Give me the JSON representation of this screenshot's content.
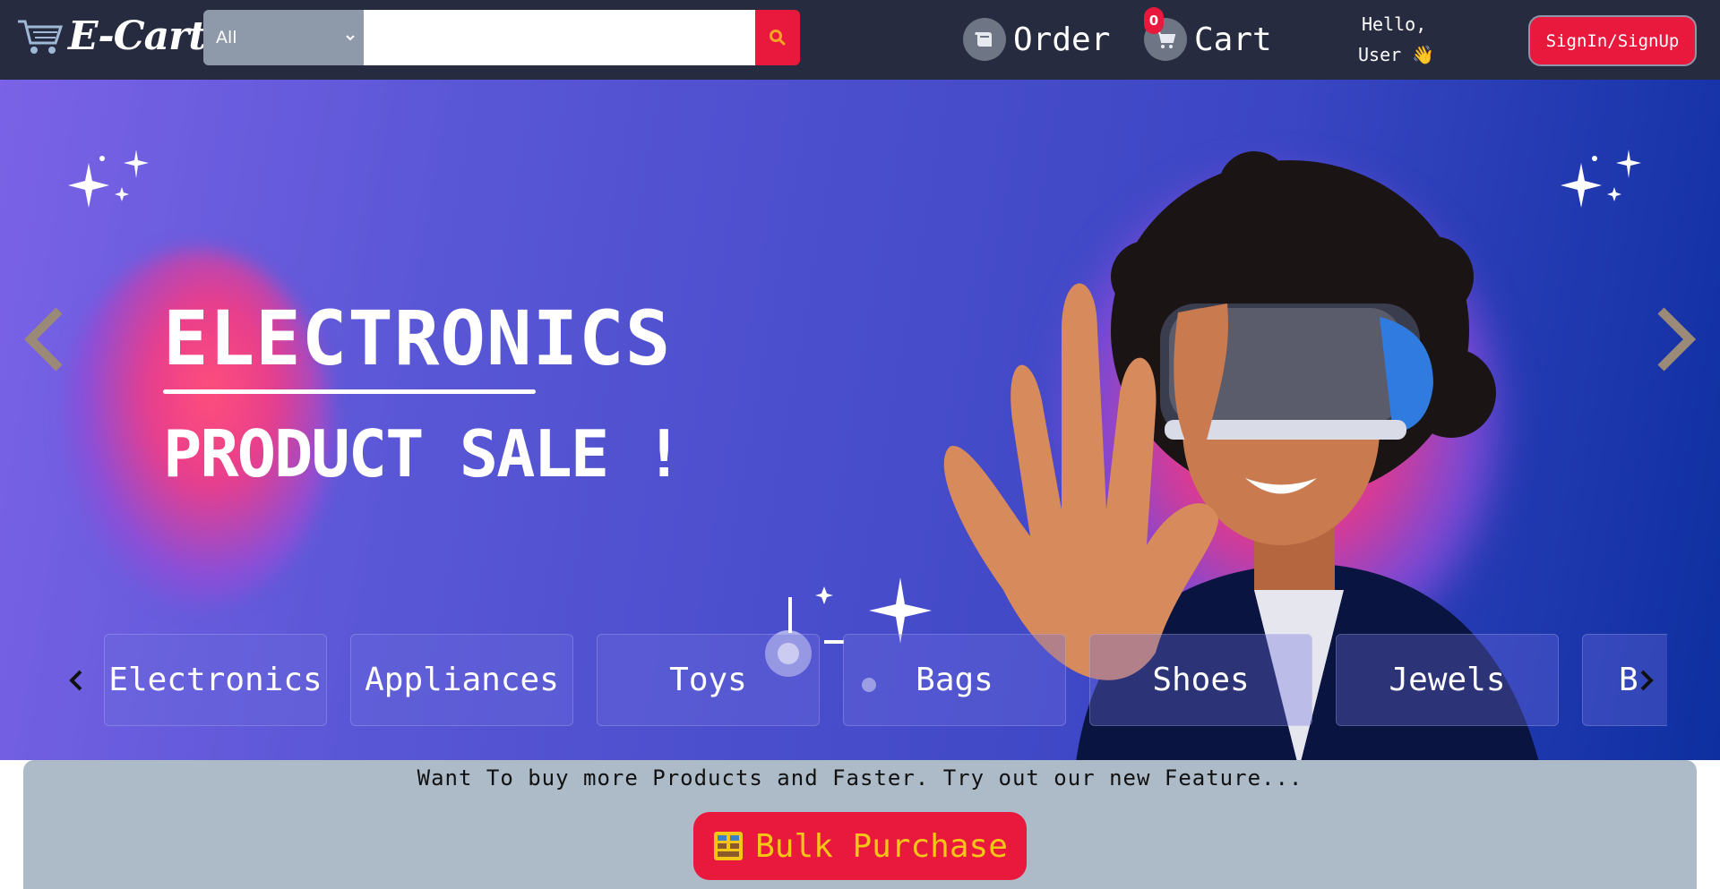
{
  "header": {
    "logo_text": "E-Cart",
    "search": {
      "category_selected": "All",
      "placeholder": "",
      "value": ""
    },
    "order_label": "Order",
    "cart_label": "Cart",
    "cart_count": "0",
    "greeting_line1": "Hello,",
    "greeting_line2": "User 👋",
    "signin_label": "SignIn/SignUp"
  },
  "hero": {
    "title": "ELECTRONICS",
    "subtitle": "PRODUCT SALE !"
  },
  "categories": {
    "items": [
      "Electronics",
      "Appliances",
      "Toys",
      "Bags",
      "Shoes",
      "Jewels",
      "B"
    ]
  },
  "promo": {
    "text": "Want To buy more Products and Faster. Try out our new Feature...",
    "button_label": "Bulk Purchase"
  },
  "colors": {
    "header_bg": "#262b3f",
    "accent_red": "#e8193c",
    "promo_bg": "#adbbc9",
    "bulk_text": "#f5c518"
  }
}
